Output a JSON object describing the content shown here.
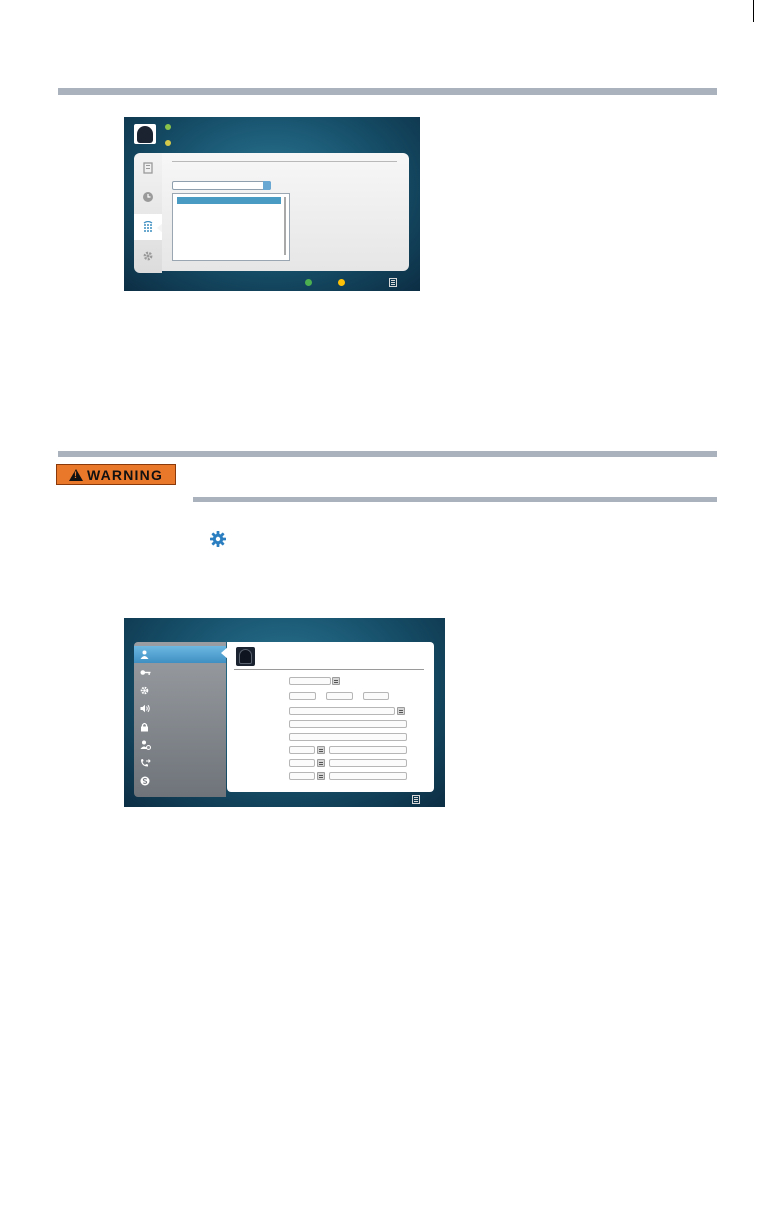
{
  "page": {
    "header_rule_color": "#aab2bd"
  },
  "screenshot_1": {
    "sidebar_icons": [
      "contacts-icon",
      "history-icon",
      "dialpad-icon",
      "settings-icon"
    ],
    "active_sidebar": "dialpad-icon",
    "status_dot_colors": [
      "#8bc34a",
      "#d4c94a"
    ],
    "footer_button_colors": [
      "#4caf50",
      "#ffc107"
    ],
    "accent_color": "#4a9bc4"
  },
  "warning": {
    "label": "WARNING",
    "badge_color": "#e9782b"
  },
  "inline_icon": "settings-gear-icon",
  "screenshot_2": {
    "menu_icons": [
      "profile-icon",
      "key-icon",
      "settings-icon",
      "audio-icon",
      "lock-icon",
      "privacy-icon",
      "call-forward-icon",
      "skype-icon"
    ],
    "active_menu": "profile-icon",
    "accent_color": "#3f8fc2"
  }
}
